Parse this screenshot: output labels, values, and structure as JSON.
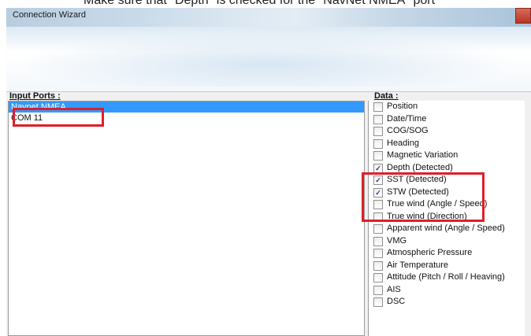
{
  "caption": "Make sure that \"Depth\" is checked for the \"NavNet NMEA\" port",
  "window": {
    "title": "Connection Wizard"
  },
  "input_ports": {
    "label": "Input Ports :",
    "items": [
      {
        "label": "Navnet NMEA",
        "selected": true
      },
      {
        "label": "COM 11",
        "selected": false
      }
    ]
  },
  "data_panel": {
    "label": "Data :",
    "items": [
      {
        "label": "Position",
        "checked": false
      },
      {
        "label": "Date/Time",
        "checked": false
      },
      {
        "label": "COG/SOG",
        "checked": false
      },
      {
        "label": "Heading",
        "checked": false
      },
      {
        "label": "Magnetic Variation",
        "checked": false
      },
      {
        "label": "Depth (Detected)",
        "checked": true
      },
      {
        "label": "SST (Detected)",
        "checked": true
      },
      {
        "label": "STW (Detected)",
        "checked": true
      },
      {
        "label": "True wind (Angle / Speed)",
        "checked": false
      },
      {
        "label": "True wind (Direction)",
        "checked": false
      },
      {
        "label": "Apparent wind (Angle / Speed)",
        "checked": false
      },
      {
        "label": "VMG",
        "checked": false
      },
      {
        "label": "Atmospheric Pressure",
        "checked": false
      },
      {
        "label": "Air Temperature",
        "checked": false
      },
      {
        "label": "Attitude (Pitch / Roll / Heaving)",
        "checked": false
      },
      {
        "label": "AIS",
        "checked": false
      },
      {
        "label": "DSC",
        "checked": false
      }
    ]
  },
  "colors": {
    "selection": "#3399ff",
    "highlight": "#dd1f2b"
  }
}
